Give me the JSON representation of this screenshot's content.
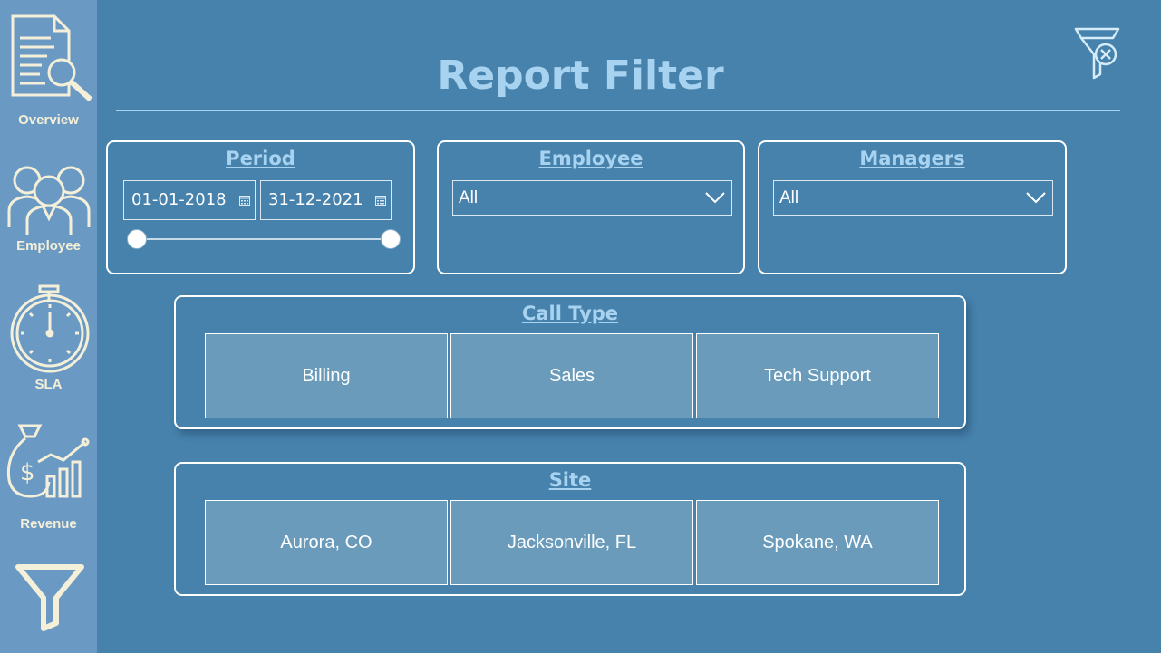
{
  "page": {
    "title": "Report Filter"
  },
  "sidebar": {
    "items": [
      {
        "label": "Overview",
        "icon": "report-document-icon"
      },
      {
        "label": "Employee",
        "icon": "employee-group-icon"
      },
      {
        "label": "SLA",
        "icon": "stopwatch-icon"
      },
      {
        "label": "Revenue",
        "icon": "money-bag-chart-icon"
      },
      {
        "label": "",
        "icon": "filter-funnel-icon"
      }
    ]
  },
  "toolbar": {
    "clear_filters_icon": "clear-filter-icon"
  },
  "filters": {
    "period": {
      "label": "Period",
      "start_date": "01-01-2018",
      "end_date": "31-12-2021",
      "slider_start": 0,
      "slider_end": 1
    },
    "employee": {
      "label": "Employee",
      "selected": "All"
    },
    "managers": {
      "label": "Managers",
      "selected": "All"
    },
    "call_type": {
      "label": "Call Type",
      "options": [
        "Billing",
        "Sales",
        "Tech Support"
      ]
    },
    "site": {
      "label": "Site",
      "options": [
        "Aurora, CO",
        "Jacksonville, FL",
        "Spokane, WA"
      ]
    }
  },
  "colors": {
    "background": "#4682ac",
    "sidebar": "#6a9ac4",
    "accent": "#a8d3f0",
    "icon": "#f4efd8",
    "tile": "#6a9bbb"
  }
}
